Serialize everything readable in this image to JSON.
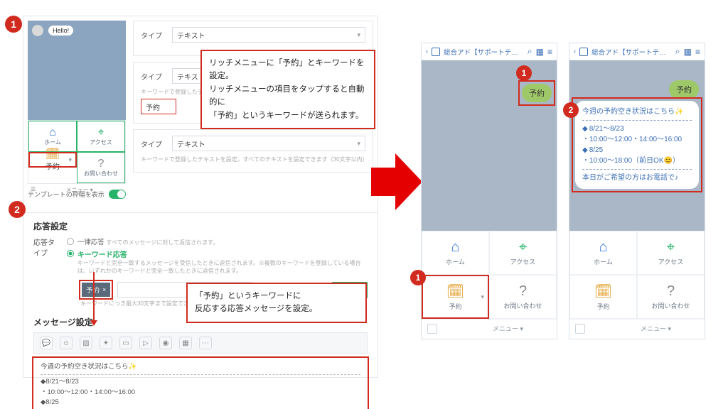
{
  "preview": {
    "hello": "Hello!",
    "cells": {
      "home": "ホーム",
      "access": "アクセス",
      "reserve": "予約",
      "contact": "お問い合わせ"
    },
    "menu_left_icon": "☰",
    "menu_label": "メニュー ▾",
    "template_width_label": "テンプレートの枠幅を表示"
  },
  "forms": {
    "type_label": "タイプ",
    "type_value": "テキスト",
    "keyword_value": "予約",
    "placeholder_hint": "キーワードで登録したテキストを設定。すべてのテキストを設定できます（30文字以内）"
  },
  "callout1": {
    "l1": "リッチメニューに「予約」とキーワードを設定。",
    "l2": "リッチメニューの項目をタップすると自動的に",
    "l3": "「予約」というキーワードが送られます。"
  },
  "resp": {
    "heading_short": "応答設定",
    "type_label": "応答タイプ",
    "opt1_label": "一律応答",
    "opt1_desc": "すべてのメッセージに対して返信されます。",
    "opt2_label": "キーワード応答",
    "opt2_desc": "キーワードと完全一致するメッセージを受信したときに返信されます。※複数のキーワードを登録している場合は、いずれかのキーワードと完全一致したときに返信されます。",
    "tag_value": "予約",
    "tag_hint": "キーワードにつき最大30文字まで設定できます。",
    "add_btn": "追加",
    "msg_heading": "メッセージ設定"
  },
  "msg_preview": {
    "l1": "今週の予約空き状況はこちら✨",
    "l2": "◆8/21〜8/23",
    "l3": "・10:00〜12:00・14:00〜16:00",
    "l4": "◆8/25"
  },
  "callout2": {
    "l1": "「予約」というキーワードに",
    "l2": "反応する応答メッセージを設定。"
  },
  "phone": {
    "back": "‹",
    "title": "総合アド【サポートテスト用...",
    "user_msg": "予約",
    "menu_home": "ホーム",
    "menu_access": "アクセス",
    "menu_reserve": "予約",
    "menu_contact": "お問い合わせ",
    "footer_menu": "メニュー ▾"
  },
  "bot_reply": {
    "l1": "今週の予約空き状況はこちら✨",
    "b1": "8/21〜8/23",
    "s1": "・10:00〜12:00・14:00〜16:00",
    "b2": "8/25",
    "s2": "・10:00〜18:00（前日OK😊）",
    "l2": "本日がご希望の方はお電話で♪"
  },
  "badges": {
    "n1": "1",
    "n2": "2"
  }
}
